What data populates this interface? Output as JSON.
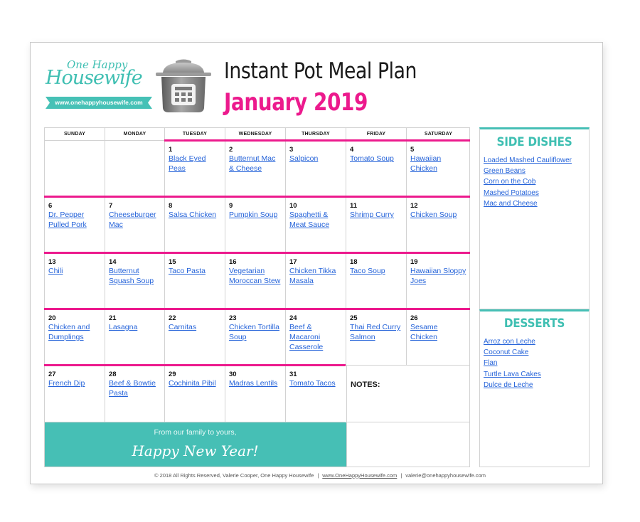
{
  "header": {
    "logo": {
      "line1": "One Happy",
      "line2": "Housewife",
      "url": "www.onehappyhousewife.com"
    },
    "pot_icon": "instant-pot-icon",
    "title": "Instant Pot Meal Plan",
    "subtitle": "January 2019"
  },
  "colors": {
    "accent_pink": "#ec1a8d",
    "accent_teal": "#46bfb5",
    "link_blue": "#2563d9"
  },
  "calendar": {
    "weekdays": [
      "SUNDAY",
      "MONDAY",
      "TUESDAY",
      "WEDNESDAY",
      "THURSDAY",
      "FRIDAY",
      "SATURDAY"
    ],
    "weeks": [
      [
        {
          "day": "",
          "meal": ""
        },
        {
          "day": "",
          "meal": ""
        },
        {
          "day": "1",
          "meal": "Black Eyed Peas"
        },
        {
          "day": "2",
          "meal": "Butternut Mac & Cheese"
        },
        {
          "day": "3",
          "meal": "Salpicon"
        },
        {
          "day": "4",
          "meal": "Tomato Soup"
        },
        {
          "day": "5",
          "meal": "Hawaiian Chicken"
        }
      ],
      [
        {
          "day": "6",
          "meal": "Dr. Pepper Pulled Pork"
        },
        {
          "day": "7",
          "meal": "Cheeseburger Mac"
        },
        {
          "day": "8",
          "meal": "Salsa Chicken"
        },
        {
          "day": "9",
          "meal": "Pumpkin Soup"
        },
        {
          "day": "10",
          "meal": "Spaghetti & Meat Sauce"
        },
        {
          "day": "11",
          "meal": "Shrimp Curry"
        },
        {
          "day": "12",
          "meal": "Chicken Soup"
        }
      ],
      [
        {
          "day": "13",
          "meal": "Chili"
        },
        {
          "day": "14",
          "meal": "Butternut Squash Soup"
        },
        {
          "day": "15",
          "meal": "Taco Pasta"
        },
        {
          "day": "16",
          "meal": "Vegetarian Moroccan Stew"
        },
        {
          "day": "17",
          "meal": "Chicken Tikka Masala"
        },
        {
          "day": "18",
          "meal": "Taco Soup"
        },
        {
          "day": "19",
          "meal": "Hawaiian Sloppy Joes"
        }
      ],
      [
        {
          "day": "20",
          "meal": "Chicken and Dumplings"
        },
        {
          "day": "21",
          "meal": "Lasagna"
        },
        {
          "day": "22",
          "meal": "Carnitas"
        },
        {
          "day": "23",
          "meal": "Chicken Tortilla Soup"
        },
        {
          "day": "24",
          "meal": "Beef & Macaroni Casserole"
        },
        {
          "day": "25",
          "meal": "Thai Red Curry Salmon"
        },
        {
          "day": "26",
          "meal": "Sesame Chicken"
        }
      ],
      [
        {
          "day": "27",
          "meal": "French Dip"
        },
        {
          "day": "28",
          "meal": "Beef & Bowtie Pasta"
        },
        {
          "day": "29",
          "meal": "Cochinita Pibil"
        },
        {
          "day": "30",
          "meal": "Madras Lentils"
        },
        {
          "day": "31",
          "meal": "Tomato Tacos"
        }
      ]
    ],
    "notes_label": "NOTES:",
    "banner": {
      "line1": "From our family to yours,",
      "line2": "Happy New Year!"
    }
  },
  "sidebar": {
    "side_dishes": {
      "title": "SIDE DISHES",
      "items": [
        "Loaded Mashed Cauliflower",
        "Green Beans",
        "Corn on the Cob",
        "Mashed Potatoes",
        "Mac and Cheese"
      ]
    },
    "desserts": {
      "title": "DESSERTS",
      "items": [
        "Arroz con Leche",
        "Coconut Cake",
        "Flan",
        "Turtle Lava Cakes",
        "Dulce de Leche"
      ]
    }
  },
  "footer": {
    "copyright": "© 2018 All Rights Reserved, Valerie Cooper, One Happy Housewife",
    "website": "www.OneHappyHousewife.com",
    "email": "valerie@onehappyhousewife.com",
    "separator": "|"
  }
}
